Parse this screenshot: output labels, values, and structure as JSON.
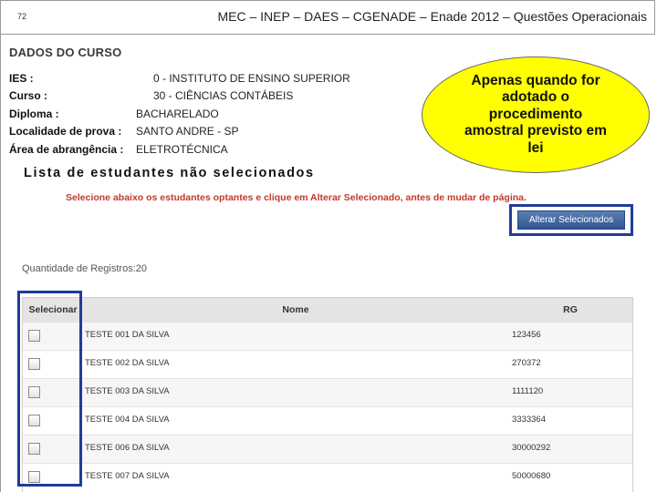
{
  "header": {
    "page_number": "72",
    "title": "MEC – INEP – DAES – CGENADE – Enade 2012 – Questões Operacionais"
  },
  "course": {
    "section_title": "DADOS DO CURSO",
    "fields": [
      {
        "label": "IES :",
        "value": "0 - INSTITUTO DE ENSINO SUPERIOR"
      },
      {
        "label": "Curso :",
        "value": "30 - CIÊNCIAS CONTÁBEIS"
      },
      {
        "label": "Diploma :",
        "value": "BACHARELADO"
      },
      {
        "label": "Localidade de prova :",
        "value": "SANTO ANDRE - SP"
      },
      {
        "label": "Área de abrangência :",
        "value": "ELETROTÉCNICA"
      }
    ]
  },
  "callout": {
    "text": "Apenas quando for adotado o procedimento amostral previsto em lei",
    "color": "#ffff00"
  },
  "list": {
    "title": "Lista de estudantes não selecionados",
    "instruction": "Selecione abaixo os estudantes optantes e clique em Alterar Selecionado, antes de mudar de página.",
    "button_label": "Alterar Selecionados",
    "record_count": "Quantidade de Registros:20"
  },
  "table": {
    "columns": [
      "Selecionar",
      "Nome",
      "RG"
    ],
    "rows": [
      {
        "nome": "TESTE 001 DA SILVA",
        "rg": "123456",
        "checked": false
      },
      {
        "nome": "TESTE 002 DA SILVA",
        "rg": "270372",
        "checked": false
      },
      {
        "nome": "TESTE 003 DA SILVA",
        "rg": "1111120",
        "checked": false
      },
      {
        "nome": "TESTE 004 DA SILVA",
        "rg": "3333364",
        "checked": false
      },
      {
        "nome": "TESTE 006 DA SILVA",
        "rg": "30000292",
        "checked": false
      },
      {
        "nome": "TESTE 007 DA SILVA",
        "rg": "50000680",
        "checked": false
      }
    ]
  },
  "colors": {
    "highlight": "#1f3c99",
    "instruction": "#c0392b",
    "button": "#2f5590"
  }
}
